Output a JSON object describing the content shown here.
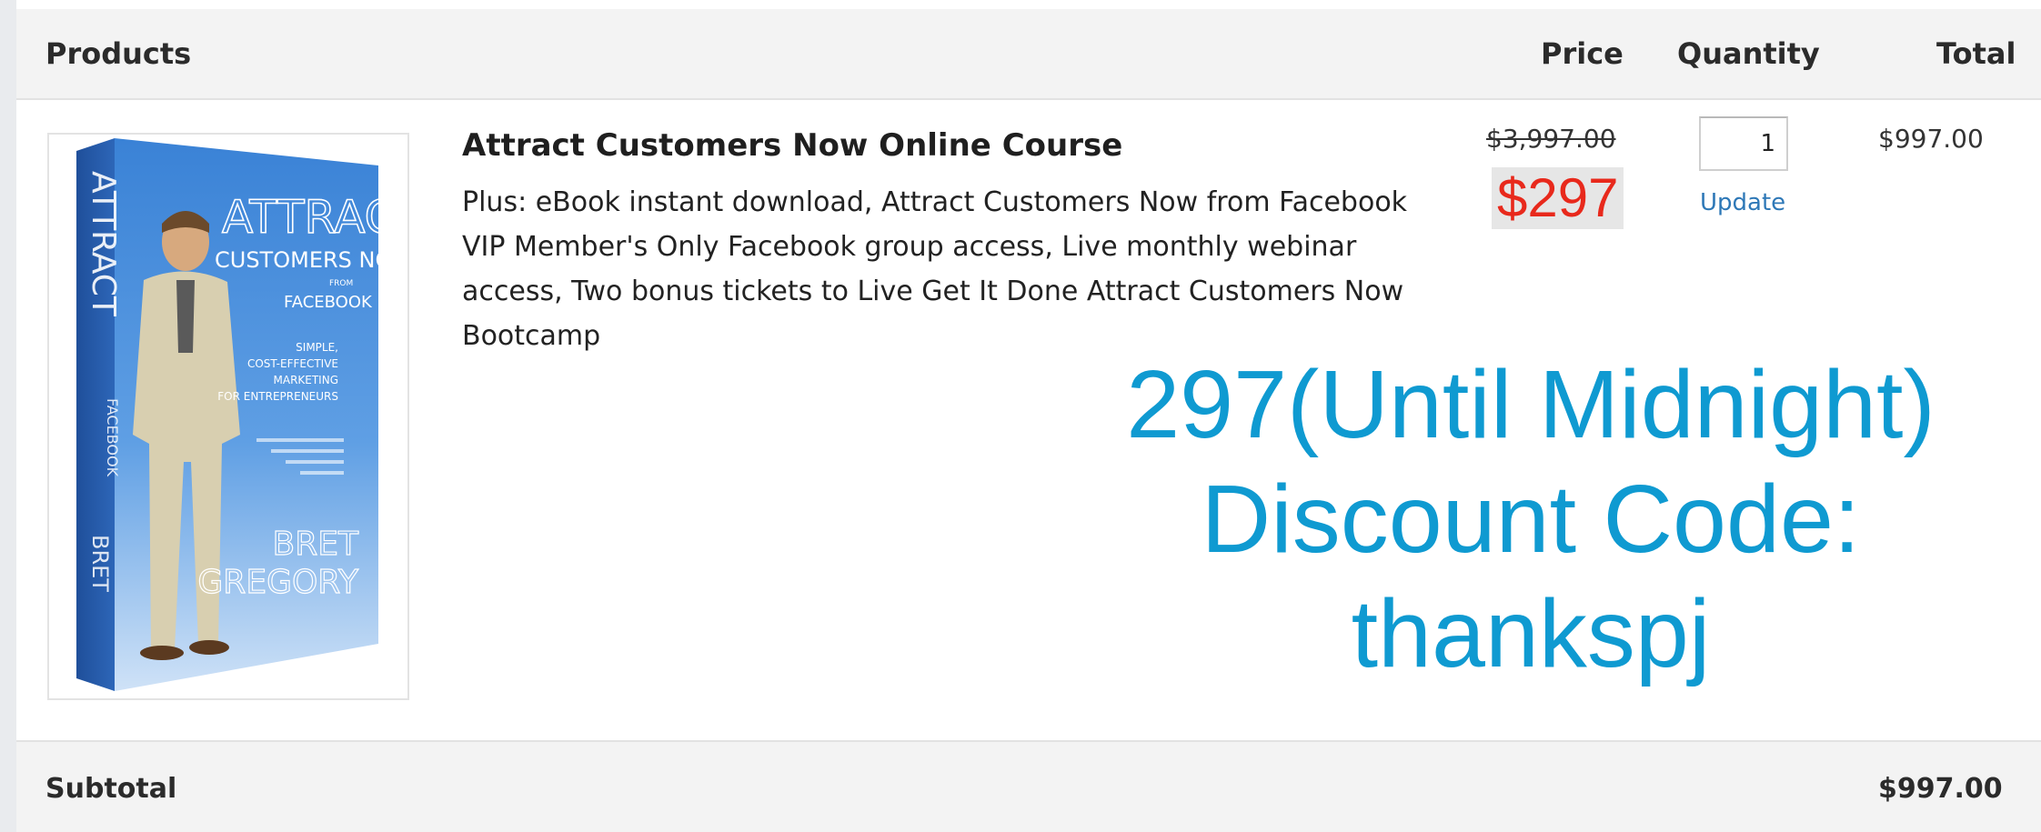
{
  "table_header": {
    "products": "Products",
    "price": "Price",
    "quantity": "Quantity",
    "total": "Total"
  },
  "item": {
    "image_name": "product-box-image",
    "title": "Attract Customers Now Online Course",
    "description": "Plus: eBook instant download, Attract Customers Now from Facebook VIP Member's Only Facebook group access, Live monthly webinar access, Two bonus tickets to Live Get It Done Attract Customers Now Bootcamp",
    "original_price": "$3,997.00",
    "sale_price": "$297",
    "quantity": "1",
    "update_label": "Update",
    "line_total": "$997.00",
    "box_art": {
      "title_line1": "ATTRACT",
      "title_line2": "CUSTOMERS NOW",
      "from": "FROM",
      "facebook": "FACEBOOK",
      "tag1": "SIMPLE,",
      "tag2": "COST-EFFECTIVE",
      "tag3": "MARKETING",
      "tag4": "FOR ENTREPRENEURS",
      "author1": "BRET",
      "author2": "GREGORY"
    }
  },
  "promo_overlay": {
    "line1": "297(Until Midnight)",
    "line2": "Discount Code:",
    "line3": "thankspj"
  },
  "subtotal": {
    "label": "Subtotal",
    "value": "$997.00"
  },
  "colors": {
    "sale_price": "#e8291c",
    "promo_text": "#0f9ad1",
    "link": "#2e78b7",
    "box_blue": "#2f6fc4"
  }
}
